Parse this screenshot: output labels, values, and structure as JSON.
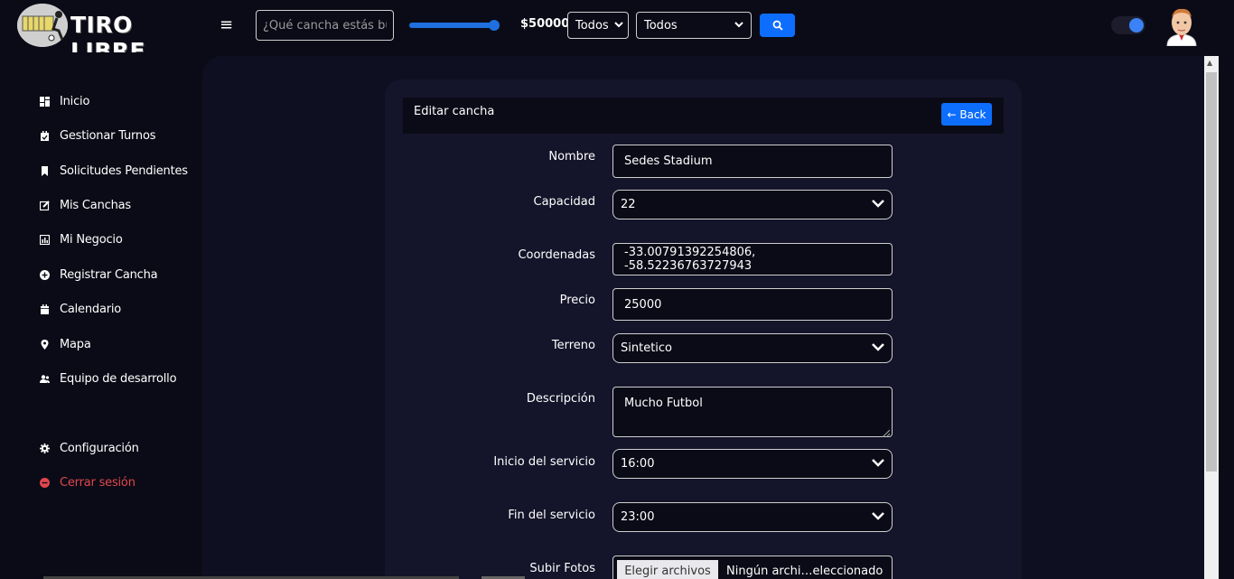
{
  "header": {
    "logo_text": "TIRO LIBRE",
    "search_placeholder": "¿Qué cancha estás bus",
    "price_label": "$50000",
    "price_slider_fraction": 0.92,
    "filter1_value": "Todos",
    "filter2_value": "Todos",
    "accent_color": "#0d6efd"
  },
  "sidebar": {
    "items": [
      {
        "label": "Inicio",
        "icon": "dashboard-icon"
      },
      {
        "label": "Gestionar Turnos",
        "icon": "calendar-check-icon"
      },
      {
        "label": "Solicitudes Pendientes",
        "icon": "bookmark-icon"
      },
      {
        "label": "Mis Canchas",
        "icon": "edit-icon"
      },
      {
        "label": "Mi Negocio",
        "icon": "chart-icon"
      },
      {
        "label": "Registrar Cancha",
        "icon": "plus-circle-icon"
      },
      {
        "label": "Calendario",
        "icon": "calendar-icon"
      },
      {
        "label": "Mapa",
        "icon": "map-pin-icon"
      },
      {
        "label": "Equipo de desarrollo",
        "icon": "people-icon"
      }
    ],
    "settings_label": "Configuración",
    "logout_label": "Cerrar sesión",
    "logout_color": "#e0474c"
  },
  "form": {
    "title": "Editar cancha",
    "back_label": "← Back",
    "fields": {
      "nombre": {
        "label": "Nombre",
        "value": "Sedes Stadium"
      },
      "capacidad": {
        "label": "Capacidad",
        "value": "22"
      },
      "coordenadas": {
        "label": "Coordenadas",
        "value": "-33.00791392254806, -58.52236763727943"
      },
      "precio": {
        "label": "Precio",
        "value": "25000"
      },
      "terreno": {
        "label": "Terreno",
        "value": "Sintetico"
      },
      "descripcion": {
        "label": "Descripción",
        "value": "Mucho Futbol"
      },
      "inicio": {
        "label": "Inicio del servicio",
        "value": "16:00"
      },
      "fin": {
        "label": "Fin del servicio",
        "value": "23:00"
      },
      "fotos": {
        "label": "Subir Fotos",
        "button": "Elegir archivos",
        "status": "Ningún archi…eleccionado"
      }
    }
  }
}
